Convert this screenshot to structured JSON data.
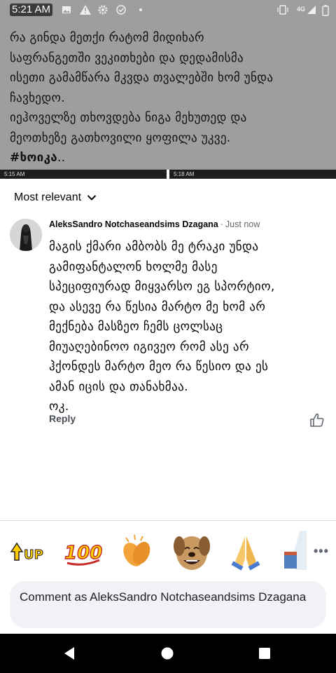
{
  "status_bar": {
    "time": "5:21 AM",
    "network": "4G"
  },
  "post": {
    "lines": [
      "რა გინდა მეთქი რატომ მიდიხარ",
      "საფრანგეთში ვეკითხები და დედამისმა",
      "ისეთი გამამწარა მკვდა თვალებში ხომ უნდა",
      "ჩავხედო.",
      "იეჰოველზე თხოვდება ნიგა მეხუთედ და",
      "მეოთხეზე გათხოვილი ყოფილა უკვე."
    ],
    "hashtag": "#ხოიკა",
    "hashtag_tail": ".."
  },
  "thumbnails": {
    "left_time": "5:15 AM",
    "right_time": "5:18 AM"
  },
  "comments": {
    "sort_label": "Most relevant",
    "items": [
      {
        "author": "AleksSandro Notchaseandsims Dzagana",
        "separator": "·",
        "timestamp": "Just now",
        "lines": [
          "მაგის ქმარი ამბობს მე ტრაკი უნდა",
          "გამიფანტალონ ხოლმე მასე",
          "სპეციფიურად მიყვარსო ეგ სპორტიო,",
          "და ასევე რა წესია მარტო მე ხომ არ",
          "მექნება მასზეო ჩემს ცოლსაც",
          "მიუაღებინოო იგივეო რომ ასე არ",
          "ჰქონდეს მარტო მეო რა წესიო და ეს",
          "ამან იცის და თანახმაა.",
          "ოკ."
        ],
        "reply_label": "Reply"
      }
    ]
  },
  "stickers": [
    "up-sticker",
    "100-sticker",
    "clapping-hands-sticker",
    "laughing-dog-sticker",
    "praying-hands-sticker",
    "partial-sticker"
  ],
  "composer": {
    "placeholder": "Comment as AleksSandro Notchaseandsims Dzagana"
  },
  "colors": {
    "dim_overlay": "#9e9e9e",
    "secondary_text": "#65676b",
    "composer_bg": "#f0f2f5"
  }
}
